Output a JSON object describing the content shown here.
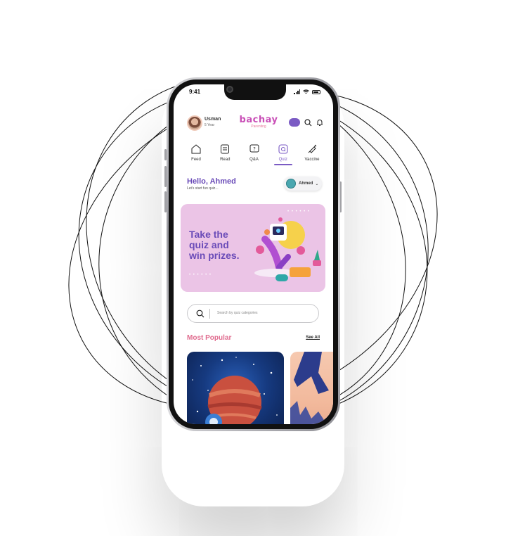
{
  "status_bar": {
    "time": "9:41"
  },
  "header": {
    "user_name": "Usman",
    "user_age": "5 Year",
    "logo_text": "bachay",
    "logo_sub": "Parenting"
  },
  "nav": {
    "items": [
      {
        "label": "Feed",
        "icon": "home-icon"
      },
      {
        "label": "Read",
        "icon": "book-icon"
      },
      {
        "label": "Q&A",
        "icon": "question-icon"
      },
      {
        "label": "Quiz",
        "icon": "quiz-icon"
      },
      {
        "label": "Vaccine",
        "icon": "syringe-icon"
      }
    ],
    "active": "Quiz"
  },
  "greeting": {
    "title": "Hello, Ahmed",
    "subtitle": "Let's start fun quiz..."
  },
  "child_selector": {
    "name": "Ahmed"
  },
  "banner": {
    "line1": "Take the",
    "line2": "quiz and",
    "line3": "win prizes."
  },
  "search": {
    "placeholder": "Search by quiz categories"
  },
  "section": {
    "title": "Most Popular",
    "see_all": "See All"
  },
  "colors": {
    "primary": "#6a4bb8",
    "accent": "#e06c8f",
    "banner_bg": "#ebc4e6"
  }
}
